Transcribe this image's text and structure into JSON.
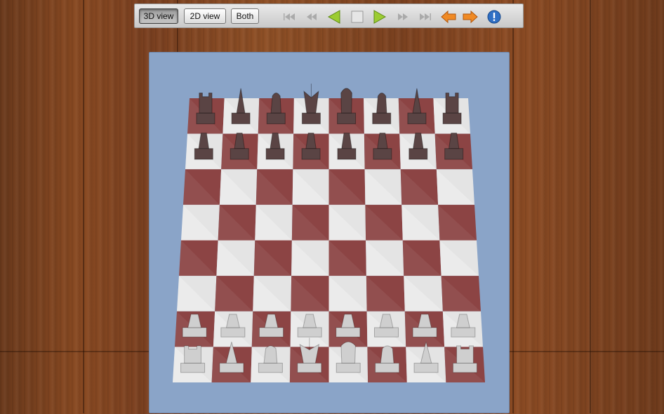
{
  "toolbar": {
    "view_buttons": [
      {
        "label": "3D view",
        "active": true
      },
      {
        "label": "2D view",
        "active": false
      },
      {
        "label": "Both",
        "active": false
      }
    ],
    "controls": [
      {
        "name": "first-move-icon"
      },
      {
        "name": "step-back-icon"
      },
      {
        "name": "play-back-icon"
      },
      {
        "name": "stop-icon"
      },
      {
        "name": "play-forward-icon"
      },
      {
        "name": "step-forward-icon"
      },
      {
        "name": "last-move-icon"
      },
      {
        "name": "arrow-left-icon"
      },
      {
        "name": "arrow-right-icon"
      },
      {
        "name": "info-icon"
      }
    ]
  },
  "board": {
    "colors": {
      "light": "#e4e4e4",
      "dark": "#8c4444",
      "panel": "#8aa4c8",
      "black_pieces": "#5a4444",
      "white_pieces": "#cfcfcf"
    },
    "back_rank": [
      "rook",
      "bishop",
      "knight",
      "queen",
      "king",
      "knight",
      "bishop",
      "rook"
    ],
    "black_back_rank": [
      "rook",
      "bishop",
      "knight",
      "queen",
      "king",
      "knight",
      "bishop",
      "rook"
    ],
    "pawns_per_side": 8
  }
}
